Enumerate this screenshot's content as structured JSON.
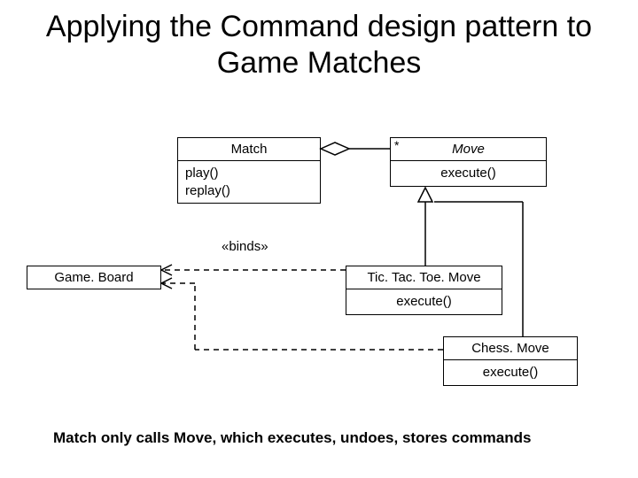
{
  "title": "Applying the Command design pattern to Game Matches",
  "classes": {
    "match": {
      "name": "Match",
      "ops": [
        "play()",
        "replay()"
      ]
    },
    "move": {
      "name": "Move",
      "ops": [
        "execute()"
      ]
    },
    "gameboard": {
      "name": "Game. Board"
    },
    "tictactoemove": {
      "name": "Tic. Tac. Toe. Move",
      "ops": [
        "execute()"
      ]
    },
    "chessmove": {
      "name": "Chess. Move",
      "ops": [
        "execute()"
      ]
    }
  },
  "labels": {
    "multiplicity": "*",
    "binds": "«binds»"
  },
  "caption": "Match only calls Move, which executes, undoes, stores commands"
}
